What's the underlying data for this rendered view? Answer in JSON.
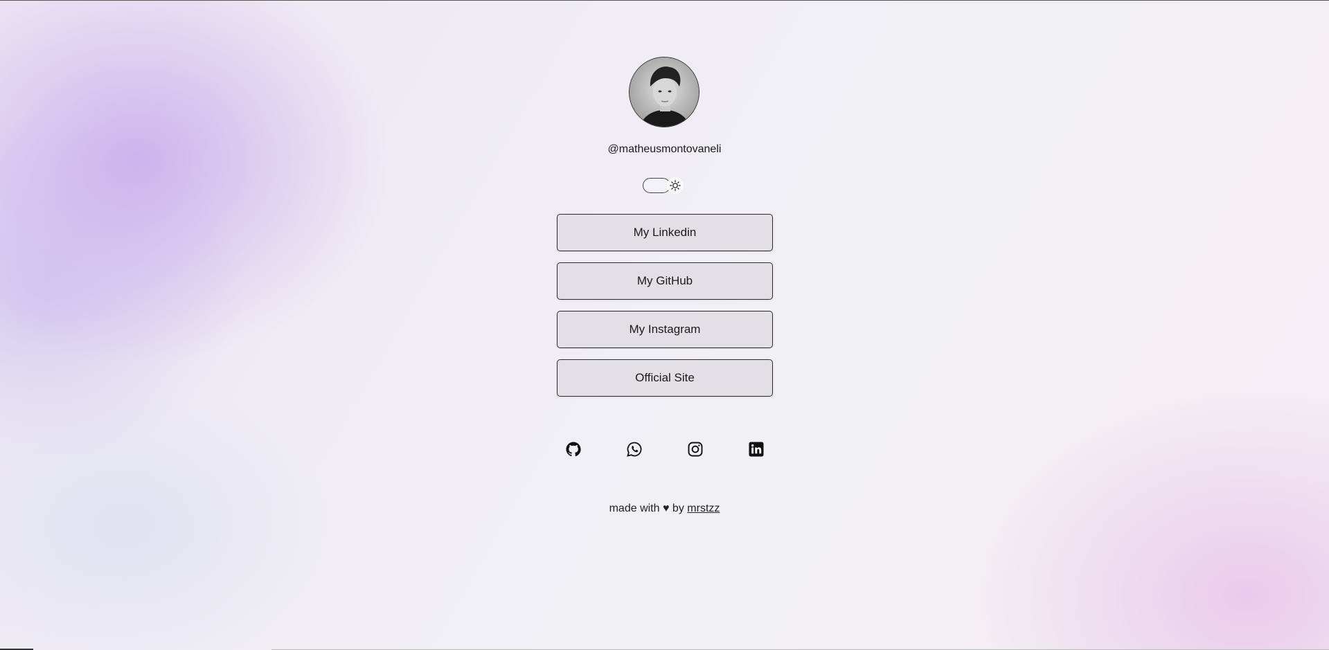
{
  "profile": {
    "username": "@matheusmontovaneli",
    "avatar_alt": "profile photo"
  },
  "theme_toggle": {
    "icon": "sun-icon",
    "state": "light"
  },
  "links": [
    {
      "label": "My Linkedin"
    },
    {
      "label": "My GitHub"
    },
    {
      "label": "My Instagram"
    },
    {
      "label": "Official Site"
    }
  ],
  "socials": [
    {
      "icon": "github-icon"
    },
    {
      "icon": "whatsapp-icon"
    },
    {
      "icon": "instagram-icon"
    },
    {
      "icon": "linkedin-icon"
    }
  ],
  "footer": {
    "prefix": "made with",
    "heart": "♥",
    "by": "by",
    "author": "mrstzz"
  },
  "colors": {
    "border": "#2a2a2a",
    "button_bg": "#e0dee2",
    "accent_purple": "#c8aaeb",
    "accent_pink": "#e8beeb"
  }
}
